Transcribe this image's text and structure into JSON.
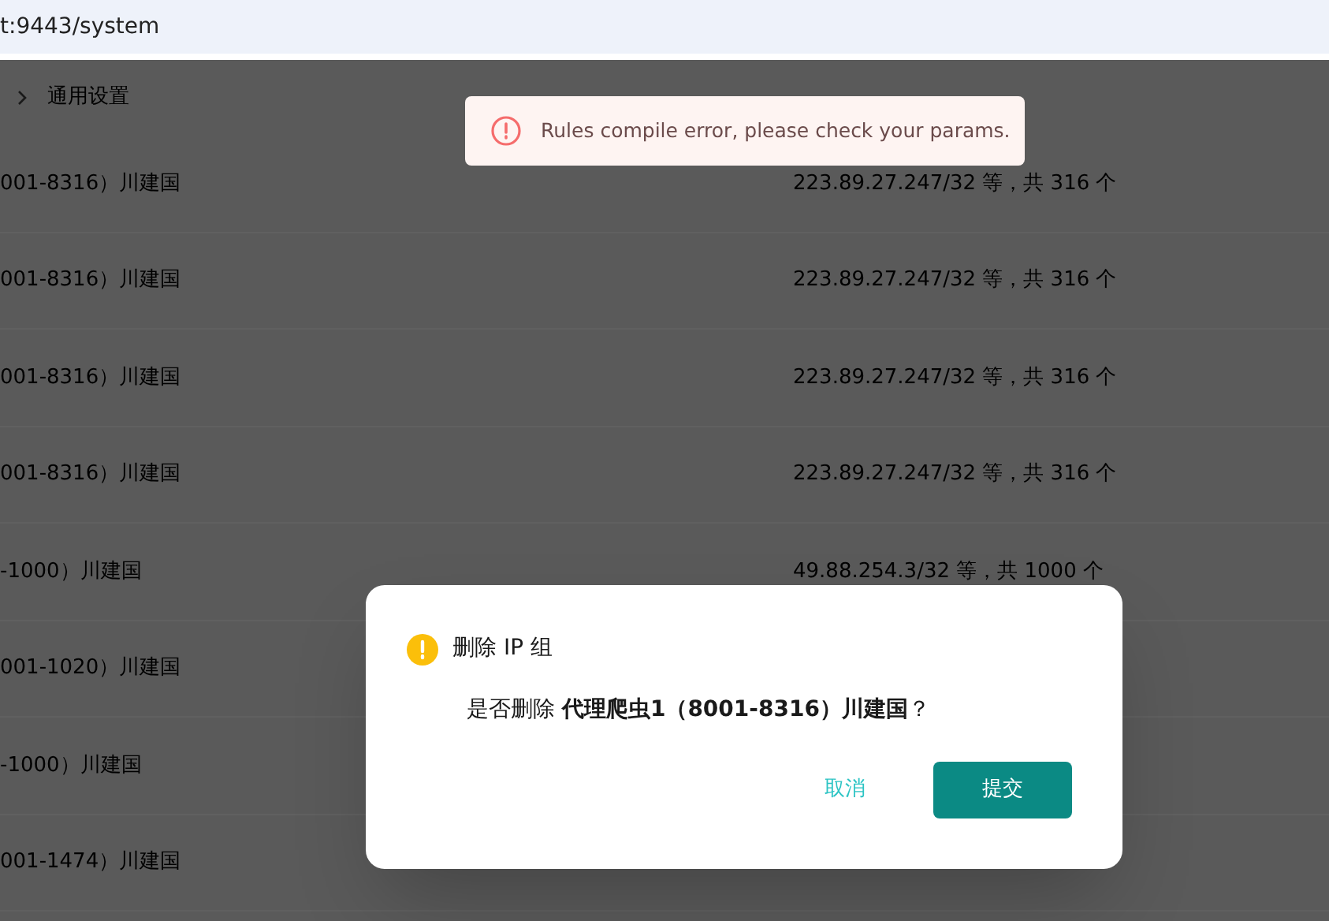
{
  "address_bar": {
    "url": "t:9443/system"
  },
  "breadcrumb": {
    "current": "通用设置"
  },
  "toast": {
    "kind": "error",
    "message": "Rules compile error, please check your params."
  },
  "table": {
    "rows": [
      {
        "column_1": "001-8316）川建国",
        "column_2": "223.89.27.247/32 等，共 316 个"
      },
      {
        "column_1": "001-8316）川建国",
        "column_2": "223.89.27.247/32 等，共 316 个"
      },
      {
        "column_1": "001-8316）川建国",
        "column_2": "223.89.27.247/32 等，共 316 个"
      },
      {
        "column_1": "001-8316）川建国",
        "column_2": "223.89.27.247/32 等，共 316 个"
      },
      {
        "column_1": "-1000）川建国",
        "column_2": "49.88.254.3/32 等，共 1000 个"
      },
      {
        "column_1": "001-1020）川建国"
      },
      {
        "column_1": "-1000）川建国"
      },
      {
        "column_1": "001-1474）川建国"
      }
    ]
  },
  "dialog": {
    "kind": "warning",
    "title": "删除 IP 组",
    "message": "是否删除 **代理爬虫1（8001-8316）川建国**？",
    "buttons": [
      {
        "label": "取消",
        "kind": "text"
      },
      {
        "label": "提交",
        "kind": "primary"
      }
    ]
  }
}
